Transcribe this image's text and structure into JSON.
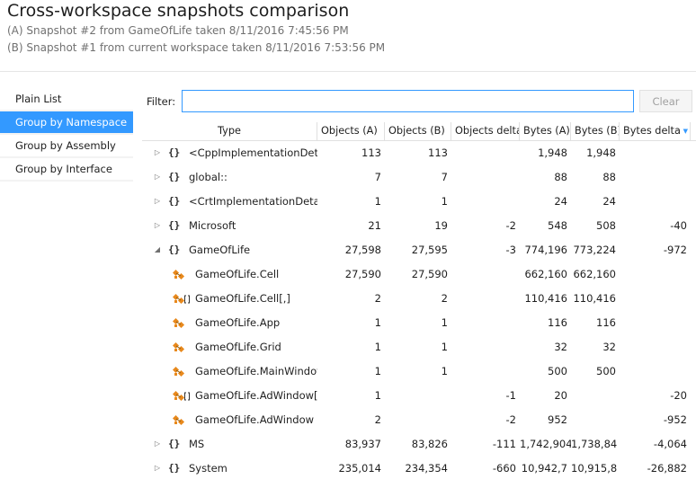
{
  "header": {
    "title": "Cross-workspace snapshots comparison",
    "snapshot_a": "(A) Snapshot #2 from GameOfLife taken 8/11/2016 7:45:56 PM",
    "snapshot_b": "(B) Snapshot #1 from current workspace taken 8/11/2016 7:53:56 PM"
  },
  "nav": {
    "items": [
      {
        "label": "Plain List",
        "active": false
      },
      {
        "label": "Group by Namespace",
        "active": true
      },
      {
        "label": "Group by Assembly",
        "active": false
      },
      {
        "label": "Group by Interface",
        "active": false
      }
    ]
  },
  "filter": {
    "label": "Filter:",
    "value": "",
    "clear_label": "Clear"
  },
  "table": {
    "columns": [
      "Type",
      "Objects (A)",
      "Objects (B)",
      "Objects delta",
      "Bytes (A)",
      "Bytes (B)",
      "Bytes delta"
    ],
    "sorted_column": "Bytes delta",
    "rows": [
      {
        "kind": "namespace",
        "expander": "collapsed",
        "name": "<CppImplementationDeta",
        "objects_a": "113",
        "objects_b": "113",
        "objects_delta": "",
        "bytes_a": "1,948",
        "bytes_b": "1,948",
        "bytes_delta": ""
      },
      {
        "kind": "namespace",
        "expander": "collapsed",
        "name": "global::",
        "objects_a": "7",
        "objects_b": "7",
        "objects_delta": "",
        "bytes_a": "88",
        "bytes_b": "88",
        "bytes_delta": ""
      },
      {
        "kind": "namespace",
        "expander": "collapsed",
        "name": "<CrtImplementationDetail",
        "objects_a": "1",
        "objects_b": "1",
        "objects_delta": "",
        "bytes_a": "24",
        "bytes_b": "24",
        "bytes_delta": ""
      },
      {
        "kind": "namespace",
        "expander": "collapsed",
        "name": "Microsoft",
        "objects_a": "21",
        "objects_b": "19",
        "objects_delta": "-2",
        "bytes_a": "548",
        "bytes_b": "508",
        "bytes_delta": "-40"
      },
      {
        "kind": "namespace",
        "expander": "expanded",
        "name": "GameOfLife",
        "objects_a": "27,598",
        "objects_b": "27,595",
        "objects_delta": "-3",
        "bytes_a": "774,196",
        "bytes_b": "773,224",
        "bytes_delta": "-972"
      },
      {
        "kind": "class",
        "array": false,
        "name": "GameOfLife.Cell",
        "objects_a": "27,590",
        "objects_b": "27,590",
        "objects_delta": "",
        "bytes_a": "662,160",
        "bytes_b": "662,160",
        "bytes_delta": ""
      },
      {
        "kind": "class",
        "array": true,
        "name": "GameOfLife.Cell[,]",
        "objects_a": "2",
        "objects_b": "2",
        "objects_delta": "",
        "bytes_a": "110,416",
        "bytes_b": "110,416",
        "bytes_delta": ""
      },
      {
        "kind": "class",
        "array": false,
        "name": "GameOfLife.App",
        "objects_a": "1",
        "objects_b": "1",
        "objects_delta": "",
        "bytes_a": "116",
        "bytes_b": "116",
        "bytes_delta": ""
      },
      {
        "kind": "class",
        "array": false,
        "name": "GameOfLife.Grid",
        "objects_a": "1",
        "objects_b": "1",
        "objects_delta": "",
        "bytes_a": "32",
        "bytes_b": "32",
        "bytes_delta": ""
      },
      {
        "kind": "class",
        "array": false,
        "name": "GameOfLife.MainWindov",
        "objects_a": "1",
        "objects_b": "1",
        "objects_delta": "",
        "bytes_a": "500",
        "bytes_b": "500",
        "bytes_delta": ""
      },
      {
        "kind": "class",
        "array": true,
        "name": "GameOfLife.AdWindow[]",
        "objects_a": "1",
        "objects_b": "",
        "objects_delta": "-1",
        "bytes_a": "20",
        "bytes_b": "",
        "bytes_delta": "-20"
      },
      {
        "kind": "class",
        "array": false,
        "name": "GameOfLife.AdWindow",
        "objects_a": "2",
        "objects_b": "",
        "objects_delta": "-2",
        "bytes_a": "952",
        "bytes_b": "",
        "bytes_delta": "-952"
      },
      {
        "kind": "namespace",
        "expander": "collapsed",
        "name": "MS",
        "objects_a": "83,937",
        "objects_b": "83,826",
        "objects_delta": "-111",
        "bytes_a": "1,742,904",
        "bytes_b": "1,738,84",
        "bytes_delta": "-4,064"
      },
      {
        "kind": "namespace",
        "expander": "collapsed",
        "name": "System",
        "objects_a": "235,014",
        "objects_b": "234,354",
        "objects_delta": "-660",
        "bytes_a": "10,942,7",
        "bytes_b": "10,915,8",
        "bytes_delta": "-26,882"
      }
    ]
  },
  "colors": {
    "accent": "#3399ff",
    "class_icon": "#e8891d"
  },
  "icons": {
    "namespace": "braces-icon",
    "class": "class-icon",
    "expand": "triangle-right-icon",
    "collapse": "triangle-down-icon"
  }
}
